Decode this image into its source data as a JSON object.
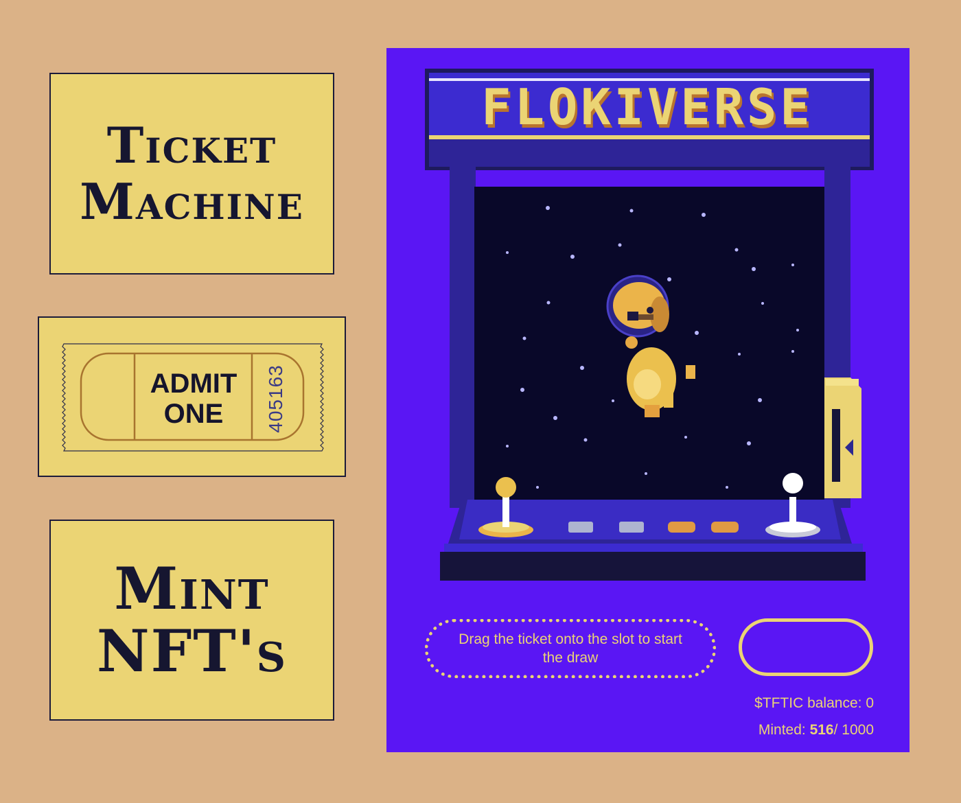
{
  "nav": {
    "ticket_machine": {
      "line1": "Ticket",
      "line2": "Machine"
    },
    "mint": {
      "line1": "Mint",
      "line2": "NFT's"
    }
  },
  "ticket": {
    "admit_line1": "ADMIT",
    "admit_line2": "ONE",
    "number": "405163"
  },
  "arcade": {
    "marquee_title": "FLOKIVERSE",
    "drag_hint": "Drag the ticket onto the slot to start the draw",
    "balance_label": "$TFTIC balance: ",
    "balance_value": "0",
    "minted_label": "Minted: ",
    "minted_value": "516",
    "minted_total": "/ 1000"
  },
  "colors": {
    "page_bg": "#dbb287",
    "card_bg": "#ebd474",
    "panel_bg": "#5a16f4",
    "accent_yellow": "#ebd474",
    "screen_bg": "#090829",
    "cabinet_dark": "#1e1a5e"
  },
  "icons": {
    "mascot": "floki-dog-astronaut-icon",
    "joystick_left": "joystick-yellow-icon",
    "joystick_right": "joystick-white-icon",
    "ticket_slot": "ticket-slot-icon"
  }
}
